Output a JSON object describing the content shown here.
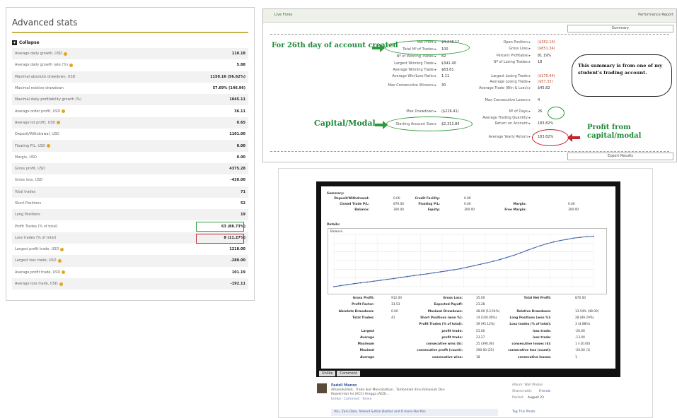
{
  "advanced_stats": {
    "title": "Advanced stats",
    "collapse_label": "Collapse",
    "rows": [
      {
        "label": "Average daily growth, USD",
        "value": "110.18",
        "info": true
      },
      {
        "label": "Average daily growth rate (%)",
        "value": "5.88",
        "info": true
      },
      {
        "label": "Maximal absolute drawdown, USD",
        "value": "1150.16 (56.62%)",
        "info": false
      },
      {
        "label": "Maximal relative drawdown",
        "value": "57.69% (146.96)",
        "info": false
      },
      {
        "label": "Maximal daily profitability growth (%)",
        "value": "1045.11",
        "info": false
      },
      {
        "label": "Average order profit, USD",
        "value": "36.11",
        "info": true
      },
      {
        "label": "Average lot profit, USD",
        "value": "0.65",
        "info": true
      },
      {
        "label": "Deposit/Withdrawal, USD",
        "value": "1101.00",
        "info": false
      },
      {
        "label": "Floating P/L, USD",
        "value": "0.00",
        "info": true
      },
      {
        "label": "Margin, USD",
        "value": "0.00",
        "info": false
      },
      {
        "label": "Gross profit, USD",
        "value": "4375.28",
        "info": false
      },
      {
        "label": "Gross loss, USD",
        "value": "-420.00",
        "info": false
      },
      {
        "label": "Total trades",
        "value": "71",
        "info": false
      },
      {
        "label": "Short Positions",
        "value": "52",
        "info": false
      },
      {
        "label": "Long Positions",
        "value": "19",
        "info": false
      },
      {
        "label": "Profit Trades (% of total)",
        "value": "63 (88.73%)",
        "info": false
      },
      {
        "label": "Loss trades (% of total)",
        "value": "8 (11.27%)",
        "info": false
      },
      {
        "label": "Largest profit trade, USD",
        "value": "1218.00",
        "info": true
      },
      {
        "label": "Largest loss trade, USD",
        "value": "-280.00",
        "info": true
      },
      {
        "label": "Average profit trade, USD",
        "value": "101.19",
        "info": true
      },
      {
        "label": "Average loss trade, USD",
        "value": "-192.11",
        "info": true
      }
    ]
  },
  "summary": {
    "tab_label": "Live Forex",
    "right_tab": "Performance Report",
    "summary_tab": "Summary",
    "export_label": "Export Results",
    "left_fields": [
      {
        "label": "Net Profit ▸",
        "value": "$4,248.12"
      },
      {
        "label": "Total Nº of Trades ▸",
        "value": "100"
      },
      {
        "label": "Nº of Winning Trades ▸",
        "value": "82"
      },
      {
        "label": "Largest Winning Trade ▸",
        "value": "$341.40"
      },
      {
        "label": "Average Winning Trade ▸",
        "value": "$63.81"
      },
      {
        "label": "Average Win/Loss Ratio ▸",
        "value": "1.11"
      },
      {
        "label": "Max Consecutive Winners ▸",
        "value": "30"
      },
      {
        "label": "Max Drawdown ▸",
        "value": "($226.41)"
      },
      {
        "label": "Starting Account Size ▸",
        "value": "$2,311.84"
      }
    ],
    "right_fields": [
      {
        "label": "Open Position ▸",
        "value": "($352.10)",
        "neg": true
      },
      {
        "label": "Gross Loss ▸",
        "value": "($851.34)",
        "neg": true
      },
      {
        "label": "Percent Profitable ▸",
        "value": "81.19%",
        "neg": false
      },
      {
        "label": "Nº of Losing Trades ▸",
        "value": "18",
        "neg": false
      },
      {
        "label": "Largest Losing Trade ▸",
        "value": "($170.44)",
        "neg": true
      },
      {
        "label": "Average Losing Trade ▸",
        "value": "($57.33)",
        "neg": true
      },
      {
        "label": "Average Trade (Win & Loss) ▸",
        "value": "$45.82",
        "neg": false
      },
      {
        "label": "Max Consecutive Losers ▸",
        "value": "4",
        "neg": false
      },
      {
        "label": "Nº of Days ▸",
        "value": "26",
        "neg": false
      },
      {
        "label": "Average Trading Quantity ▸",
        "value": "",
        "neg": false
      },
      {
        "label": "Return on Account ▸",
        "value": "183.82%",
        "neg": false
      },
      {
        "label": "Average Yearly Return ▸",
        "value": "183.82%",
        "neg": false
      }
    ],
    "annotations": {
      "day26": "For 26th day of account created",
      "capital": "Capital/Modal",
      "profit": "Profit from capital/modal",
      "bubble": "This summary is from one of my student's trading account."
    }
  },
  "statement": {
    "summary_heading": "Summary:",
    "top_rows": [
      [
        "Deposit/Withdrawal:",
        "0.00",
        "Credit Facility:",
        "0.00",
        "",
        ""
      ],
      [
        "Closed Trade P/L:",
        "870.00",
        "Floating P/L:",
        "0.00",
        "Margin:",
        "0.00"
      ],
      [
        "Balance:",
        "300.00",
        "Equity:",
        "300.00",
        "Free Margin:",
        "300.00"
      ]
    ],
    "details_heading": "Details:",
    "chart_label": "Balance",
    "bottom_rows": [
      [
        "Gross Profit:",
        "912.00",
        "Gross Loss:",
        "35.00",
        "Total Net Profit:",
        "870.00"
      ],
      [
        "Profit Factor:",
        "33.53",
        "Expected Payoff:",
        "21.28",
        "",
        ""
      ],
      [
        "Absolute Drawdown:",
        "0.00",
        "Maximal Drawdown:",
        "48.00 (13.54%)",
        "Relative Drawdown:",
        "13.54% (48.00)"
      ],
      [
        "Total Trades:",
        "41",
        "Short Positions (won %):",
        "14 (100.00%)",
        "Long Positions (won %):",
        "28 (89.29%)"
      ],
      [
        "",
        "",
        "Profit Trades (% of total):",
        "39 (95.12%)",
        "Loss trades (% of total):",
        "3 (4.88%)"
      ],
      [
        "Largest",
        "",
        "profit trade:",
        "51.00",
        "loss trade:",
        "-20.00"
      ],
      [
        "Average",
        "",
        "profit trade:",
        "23.27",
        "loss trade:",
        "-13.00"
      ],
      [
        "Maximum",
        "",
        "consecutive wins ($):",
        "25 (390.00)",
        "consecutive losses ($):",
        "1 (-20.00)"
      ],
      [
        "Maximal",
        "",
        "consecutive profit (count):",
        "390.00 (25)",
        "consecutive loss (count):",
        "-20.00 (1)"
      ],
      [
        "Average",
        "",
        "consecutive wins:",
        "18",
        "consecutive losses:",
        "1"
      ]
    ],
    "tabs": [
      "Unlike",
      "Comment"
    ]
  },
  "chart_data": {
    "type": "line",
    "title": "",
    "series": [
      {
        "name": "Balance",
        "values": [
          0,
          18,
          34,
          52,
          66,
          79,
          95,
          110,
          126,
          140,
          158,
          175,
          190,
          206,
          220,
          238,
          255,
          272,
          290,
          310,
          335,
          360,
          385,
          410,
          440,
          470,
          505,
          540,
          580,
          625,
          665,
          705,
          740,
          770,
          795,
          815,
          835,
          850,
          862,
          870
        ]
      }
    ],
    "grid": true
  },
  "post": {
    "author": "Fadzli Manzo",
    "text_line1": "Alhamdulillah.. Trade ikut Mencatatkan.. Tambahlah Ilmu Rohaniah Dan",
    "text_line2": "Rezeki Hari Ini (ACC) Hingga (AED)...",
    "actions": "Unlike · Comment · Share",
    "comment": "You, Zain Dalo, Ahmad Sufian Bashar and 6 more like this",
    "side_album": "Album: Wall Photos",
    "side_shared": "Shared with:",
    "side_friends": "Friends",
    "side_posted": "Posted:",
    "side_date": "August 23",
    "side_tag": "Tag This Photo"
  }
}
